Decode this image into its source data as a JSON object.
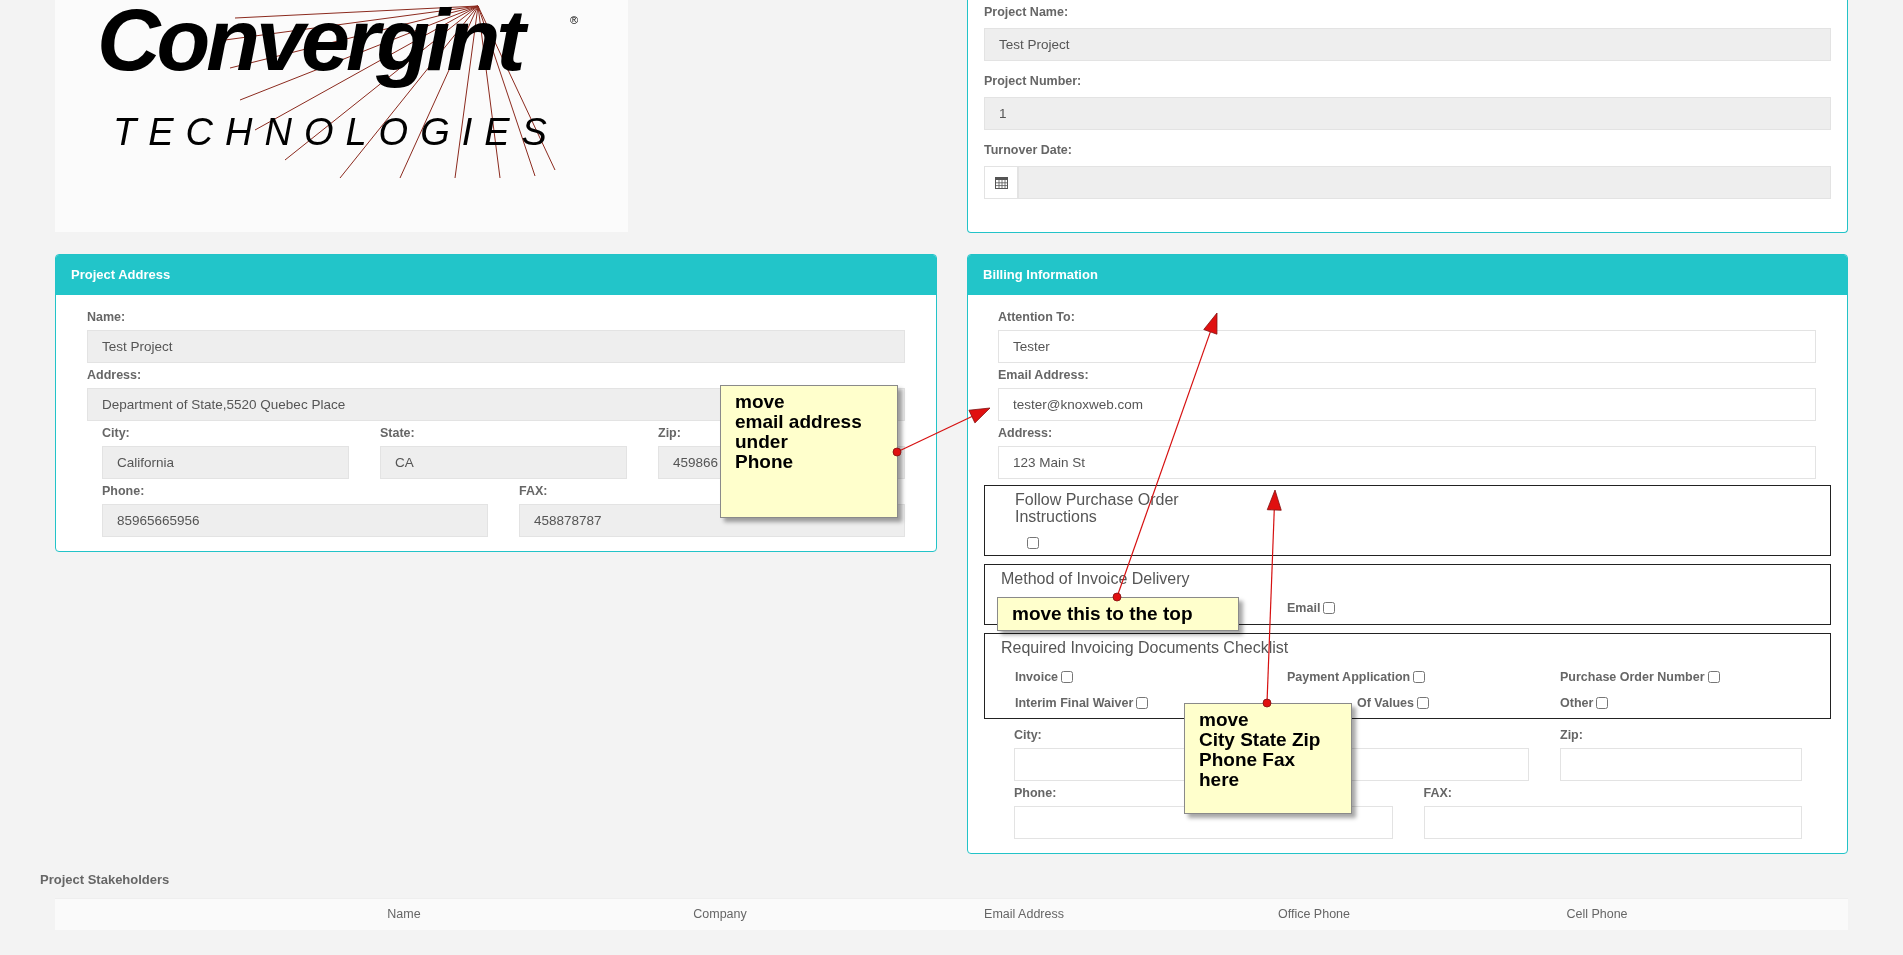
{
  "logo": {
    "wordmark": "Convergint",
    "registered": "®",
    "tagline": "TECHNOLOGIES"
  },
  "project_info": {
    "fields": [
      {
        "label": "Project Name:",
        "value": "Test Project",
        "disabled": true
      },
      {
        "label": "Project Number:",
        "value": "1",
        "disabled": true
      },
      {
        "label": "Turnover Date:",
        "disabled": true,
        "kind": "date"
      }
    ]
  },
  "project_address": {
    "title": "Project Address",
    "rows": [
      [
        {
          "label": "Name:",
          "value": "Test Project",
          "disabled": true
        }
      ],
      [
        {
          "label": "Address:",
          "value": "Department of State,5520 Quebec Place",
          "disabled": true
        }
      ],
      [
        {
          "label": "City:",
          "value": "California",
          "disabled": true
        },
        {
          "label": "State:",
          "value": "CA",
          "disabled": true
        },
        {
          "label": "Zip:",
          "value": "459866",
          "disabled": true
        }
      ],
      [
        {
          "label": "Phone:",
          "value": "85965665956",
          "disabled": true
        },
        {
          "label": "FAX:",
          "value": "458878787",
          "disabled": true
        }
      ]
    ]
  },
  "billing": {
    "title": "Billing Information",
    "rows": [
      [
        {
          "label": "Attention To:",
          "value": "Tester",
          "disabled": false
        }
      ],
      [
        {
          "label": "Email Address:",
          "value": "tester@knoxweb.com",
          "disabled": false
        }
      ],
      [
        {
          "label": "Address:",
          "value": "123 Main St",
          "disabled": false
        }
      ]
    ],
    "fieldsets": [
      {
        "kind": "single",
        "legend": "Follow Purchase Order Instructions",
        "checkboxes": [
          {
            "checked": false
          }
        ]
      },
      {
        "kind": "options",
        "legend": "Method of Invoice Delivery",
        "checkboxes": [
          {
            "label": "Email",
            "checked": false
          }
        ]
      },
      {
        "kind": "grid",
        "legend": "Required Invoicing Documents Checklist",
        "checkboxes": [
          {
            "label": "Invoice",
            "checked": false
          },
          {
            "label": "Payment Application",
            "checked": false
          },
          {
            "label": "Purchase Order Number",
            "checked": false
          },
          {
            "label": "Interim Final Waiver",
            "checked": false
          },
          {
            "label": "Of Values",
            "checked": false
          },
          {
            "label": "Other",
            "checked": false
          }
        ]
      }
    ],
    "rows_after": [
      [
        {
          "label": "City:",
          "disabled": false
        },
        {
          "disabled": false
        },
        {
          "label": "Zip:",
          "disabled": false
        }
      ],
      [
        {
          "label": "Phone:",
          "disabled": false
        },
        {
          "label": "FAX:",
          "disabled": false
        }
      ]
    ]
  },
  "stakeholders": {
    "title": "Project Stakeholders",
    "columns": [
      "Name",
      "Company",
      "Email Address",
      "Office Phone",
      "Cell Phone"
    ]
  },
  "annotations": [
    {
      "lines": [
        "move",
        "email address",
        "under",
        "Phone"
      ]
    },
    {
      "lines": [
        "move this to the top"
      ]
    },
    {
      "lines": [
        "move",
        "City State Zip",
        "Phone Fax",
        "here"
      ]
    }
  ]
}
